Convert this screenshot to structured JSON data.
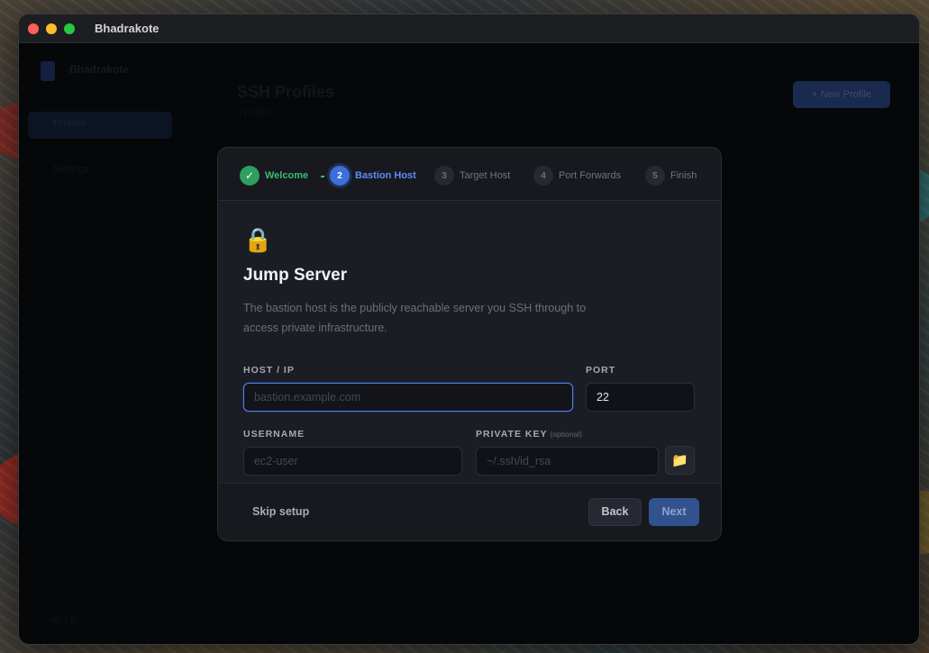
{
  "window": {
    "title": "Bhadrakote"
  },
  "background": {
    "brand": "Bhadrakote",
    "nav": [
      "Profiles",
      "Settings"
    ],
    "page_title": "SSH Profiles",
    "page_subtitle": "0 profiles",
    "button_label": "+ New Profile",
    "version": "v0.1.0"
  },
  "stepper": {
    "steps": [
      {
        "number": "✓",
        "label": "Welcome",
        "state": "done"
      },
      {
        "number": "2",
        "label": "Bastion Host",
        "state": "active"
      },
      {
        "number": "3",
        "label": "Target Host",
        "state": "todo"
      },
      {
        "number": "4",
        "label": "Port Forwards",
        "state": "todo"
      },
      {
        "number": "5",
        "label": "Finish",
        "state": "todo"
      }
    ]
  },
  "content": {
    "icon": "lock-icon",
    "icon_glyph": "🔒",
    "heading": "Jump Server",
    "description": "The bastion host is the publicly reachable server you SSH through to access private infrastructure."
  },
  "form": {
    "host": {
      "label": "HOST / IP",
      "placeholder": "bastion.example.com",
      "value": ""
    },
    "port": {
      "label": "PORT",
      "value": "22"
    },
    "username": {
      "label": "USERNAME",
      "placeholder": "ec2-user",
      "value": ""
    },
    "private_key": {
      "label": "PRIVATE KEY",
      "optional_note": "(optional)",
      "placeholder": "~/.ssh/id_rsa",
      "value": ""
    },
    "browse_icon_glyph": "📁"
  },
  "footer": {
    "skip_label": "Skip setup",
    "back_label": "Back",
    "next_label": "Next"
  },
  "colors": {
    "accent": "#4d7ff0",
    "success": "#3dbb73",
    "modal_bg": "#1b1d24"
  }
}
